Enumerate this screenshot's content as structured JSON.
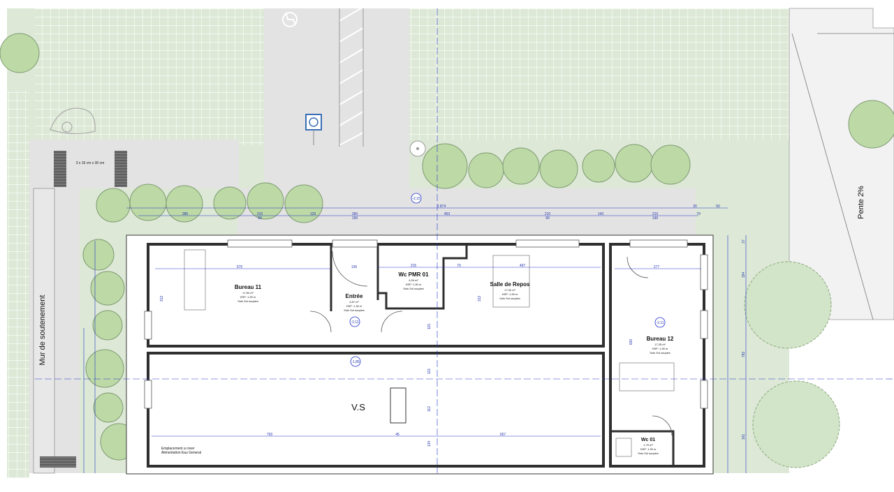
{
  "rooms": [
    {
      "id": "bureau11",
      "name": "Bureau 11",
      "area": "17,84 m²",
      "hsp": "HSP: 1,90 m",
      "sol": "Sols Sol souples"
    },
    {
      "id": "entree",
      "name": "Entrée",
      "area": "4,87 m²",
      "hsp": "HSP: 1,90 m",
      "sol": "Sols Sol souples"
    },
    {
      "id": "wcpmr",
      "name": "Wc PMR 01",
      "area": "4,09 m²",
      "hsp": "HSP: 1,90 m",
      "sol": "Sols Sol souples"
    },
    {
      "id": "repos",
      "name": "Salle de Repos",
      "area": "17,90 m²",
      "hsp": "HSP: 1,90 m",
      "sol": "Sols Sol souples"
    },
    {
      "id": "bureau12",
      "name": "Bureau 12",
      "area": "17,35 m²",
      "hsp": "HSP: 1,90 m",
      "sol": "Sols Sol souples"
    },
    {
      "id": "wc01",
      "name": "Wc 01",
      "area": "1,75 m²",
      "hsp": "HSP: 1,90 m",
      "sol": "Sols Sol souples"
    }
  ],
  "labels": {
    "vs": "V.S",
    "mur": "Mur de soutenement",
    "pente": "Pente 2%",
    "grille": "3 x 16 cm x 30 cm",
    "note_line1": "Emplacement a creer",
    "note_line2": "Alimentation Eau General"
  },
  "levels": {
    "top": "-2,15",
    "ent": "-2,11",
    "ext": "-1,85",
    "b12": "-2,11"
  },
  "dimensions": {
    "top_row1": [
      "1 874",
      "30",
      "50"
    ],
    "top_row2": [
      "286",
      "210",
      "133",
      "350",
      "453",
      "210",
      "143",
      "210",
      "79"
    ],
    "top_row3": [
      "90",
      "190",
      "90",
      "190"
    ],
    "inner_b11": [
      "575",
      "136"
    ],
    "inner_rep": [
      "215",
      "70",
      "497"
    ],
    "inner_b12": [
      "277"
    ],
    "bottom": [
      "793",
      "45",
      "657"
    ],
    "vertical": [
      "312",
      "121",
      "115",
      "112",
      "134",
      "312",
      "600",
      "194",
      "782",
      "161",
      "27"
    ]
  },
  "colors": {
    "lawn": "#dde9d6",
    "pavement": "#e3e3e3",
    "wall": "#2f2f2f",
    "dim": "#2233cc",
    "tree": "#bcd9a6",
    "treeStroke": "#7f9a72",
    "grid": "#ffffff"
  }
}
